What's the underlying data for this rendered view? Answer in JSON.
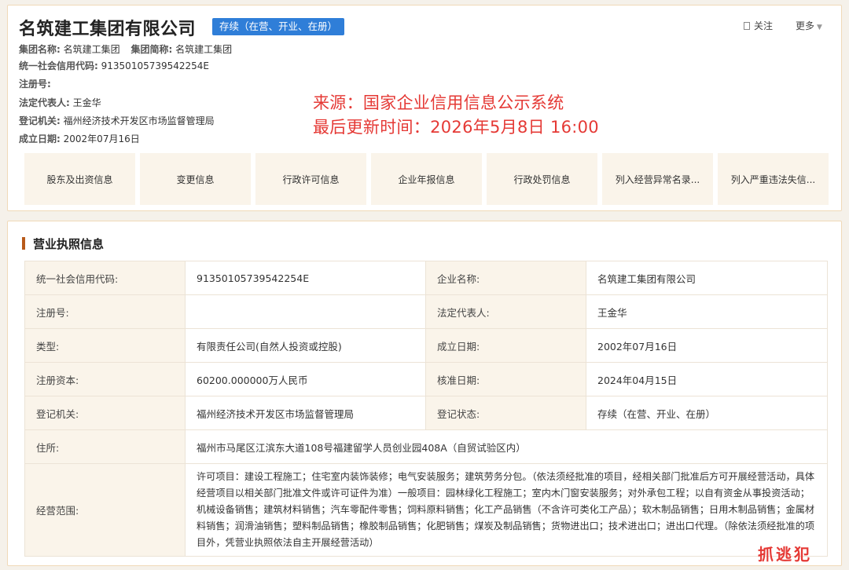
{
  "header": {
    "company_name": "名筑建工集团有限公司",
    "status_tag": "存续（在营、开业、在册）",
    "follow_label": "关注",
    "more_label": "更多"
  },
  "basic_info": {
    "group_name_label": "集团名称:",
    "group_name": "名筑建工集团",
    "group_short_label": "集团简称:",
    "group_short": "名筑建工集团",
    "credit_code_label": "统一社会信用代码:",
    "credit_code": "91350105739542254E",
    "reg_no_label": "注册号:",
    "reg_no": "",
    "legal_rep_label": "法定代表人:",
    "legal_rep": "王金华",
    "reg_authority_label": "登记机关:",
    "reg_authority": "福州经济技术开发区市场监督管理局",
    "founded_label": "成立日期:",
    "founded": "2002年07月16日"
  },
  "source_note": {
    "line1": "来源：国家企业信用信息公示系统",
    "line2": "最后更新时间：2026年5月8日 16:00"
  },
  "tabs": [
    "股东及出资信息",
    "变更信息",
    "行政许可信息",
    "企业年报信息",
    "行政处罚信息",
    "列入经营异常名录...",
    "列入严重违法失信..."
  ],
  "license": {
    "title": "营业执照信息",
    "rows": [
      [
        "统一社会信用代码:",
        "91350105739542254E",
        "企业名称:",
        "名筑建工集团有限公司"
      ],
      [
        "注册号:",
        "",
        "法定代表人:",
        "王金华"
      ],
      [
        "类型:",
        "有限责任公司(自然人投资或控股)",
        "成立日期:",
        "2002年07月16日"
      ],
      [
        "注册资本:",
        "60200.000000万人民币",
        "核准日期:",
        "2024年04月15日"
      ],
      [
        "登记机关:",
        "福州经济技术开发区市场监督管理局",
        "登记状态:",
        "存续（在营、开业、在册）"
      ]
    ],
    "address_label": "住所:",
    "address": "福州市马尾区江滨东大道108号福建留学人员创业园408A（自贸试验区内）",
    "scope_label": "经营范围:",
    "scope": "许可项目：建设工程施工；住宅室内装饰装修；电气安装服务；建筑劳务分包。（依法须经批准的项目，经相关部门批准后方可开展经营活动，具体经营项目以相关部门批准文件或许可证件为准）一般项目：园林绿化工程施工；室内木门窗安装服务；对外承包工程；以自有资金从事投资活动；机械设备销售；建筑材料销售；汽车零配件零售；饲料原料销售；化工产品销售（不含许可类化工产品）；软木制品销售；日用木制品销售；金属材料销售；润滑油销售；塑料制品销售；橡胶制品销售；化肥销售；煤炭及制品销售；货物进出口；技术进出口；进出口代理。（除依法须经批准的项目外，凭营业执照依法自主开展经营活动）"
  },
  "watermark": "抓逃犯"
}
